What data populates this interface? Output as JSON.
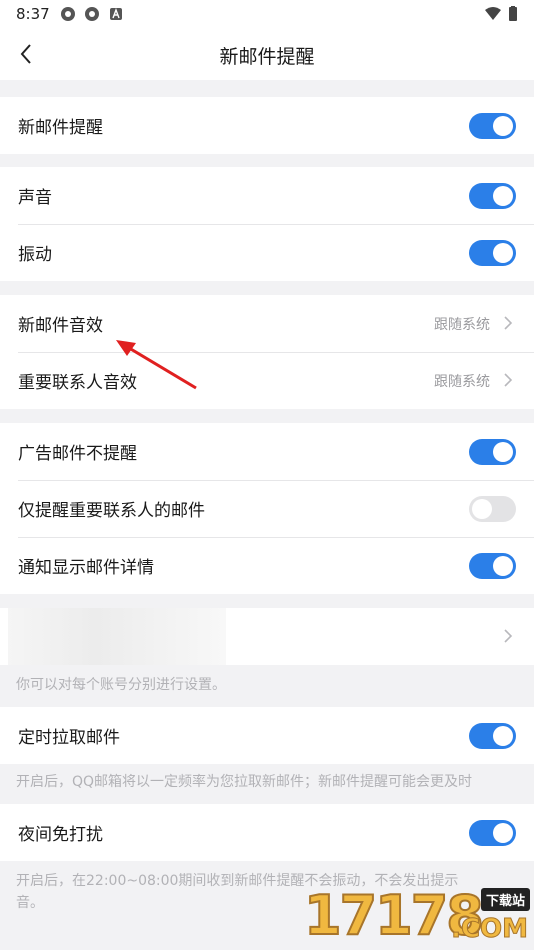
{
  "status": {
    "time": "8:37"
  },
  "nav": {
    "title": "新邮件提醒"
  },
  "g1": {
    "new_mail_alert": "新邮件提醒"
  },
  "g2": {
    "sound": "声音",
    "vibrate": "振动"
  },
  "g3": {
    "new_mail_sound": "新邮件音效",
    "new_mail_sound_value": "跟随系统",
    "vip_sound": "重要联系人音效",
    "vip_sound_value": "跟随系统"
  },
  "g4": {
    "no_ad_alert": "广告邮件不提醒",
    "vip_only": "仅提醒重要联系人的邮件",
    "show_detail": "通知显示邮件详情"
  },
  "g5": {
    "hint": "你可以对每个账号分别进行设置。"
  },
  "g6": {
    "scheduled_fetch": "定时拉取邮件",
    "hint": "开启后，QQ邮箱将以一定频率为您拉取新邮件；新邮件提醒可能会更及时"
  },
  "g7": {
    "night_dnd": "夜间免打扰",
    "hint_line1": "开启后，在22:00~08:00期间收到新邮件提醒不会振动，不会发出提示",
    "hint_line2": "音。"
  },
  "toggles": {
    "new_mail_alert": true,
    "sound": true,
    "vibrate": true,
    "no_ad_alert": true,
    "vip_only": false,
    "show_detail": true,
    "scheduled_fetch": true,
    "night_dnd": true
  },
  "watermark": {
    "number": "17178",
    "tag": "下载站",
    "domain": ".COM"
  },
  "colors": {
    "accent": "#2b7fe8",
    "arrow": "#e02020"
  }
}
